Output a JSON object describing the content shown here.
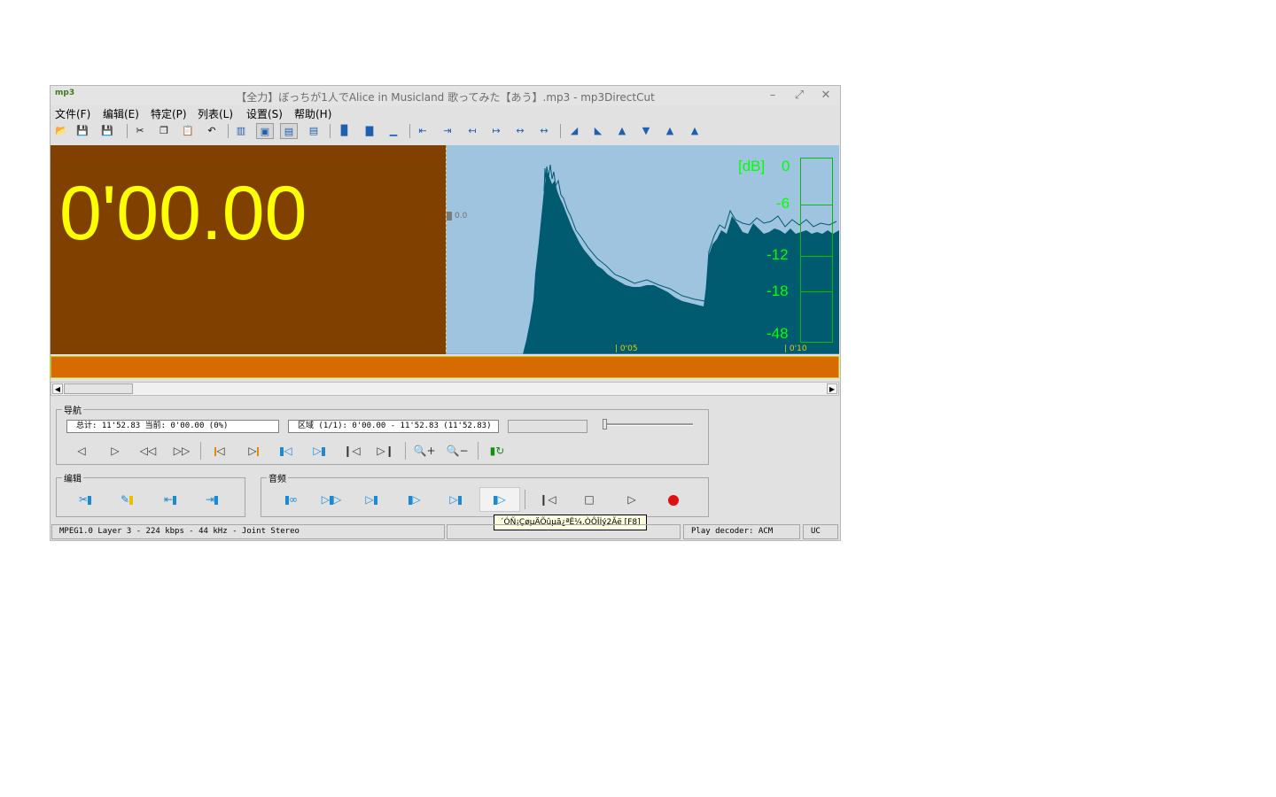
{
  "window": {
    "icon_label": "mp3",
    "title": "【全力】ぼっちが1人でAlice in Musicland 歌ってみた【あう】.mp3 - mp3DirectCut",
    "minimize": "–",
    "maximize": "⤢",
    "close": "✕"
  },
  "menu": [
    {
      "label": "文件(F)"
    },
    {
      "label": "编辑(E)"
    },
    {
      "label": "特定(P)"
    },
    {
      "label": "列表(L)"
    },
    {
      "label": "设置(S)"
    },
    {
      "label": "帮助(H)"
    }
  ],
  "display": {
    "time": "0'00.00",
    "marker_label": "0.0",
    "time_labels": [
      "0'05",
      "0'10"
    ],
    "db_labels": [
      "[dB]",
      "0",
      "-6",
      "-12",
      "-18",
      "-48"
    ],
    "colors": {
      "time_background": "#804000",
      "time_text": "#ffff00",
      "wave_background": "#9fc4e0",
      "wave_fill": "#005a70",
      "meter": "#00ff00",
      "selection_bar": "#d86b00"
    }
  },
  "navigation": {
    "label": "导航",
    "info_text": "总计: 11'52.83   当前: 0'00.00   (0%)",
    "region_text": "区域 (1/1): 0'00.00 - 11'52.83 (11'52.83)",
    "volume_level": 0
  },
  "edit_group": {
    "label": "编辑"
  },
  "audio_group": {
    "label": "音频"
  },
  "tooltip": "´ÓÑ¡ÇøµÄÕûµã¿ªÊ¼,ÒÔÎÍý2Ãë    [F8]",
  "status": {
    "format": "MPEG1.0 Layer 3 - 224 kbps - 44 kHz - Joint Stereo",
    "middle": "",
    "decoder": "Play decoder: ACM",
    "uc": "UC"
  }
}
